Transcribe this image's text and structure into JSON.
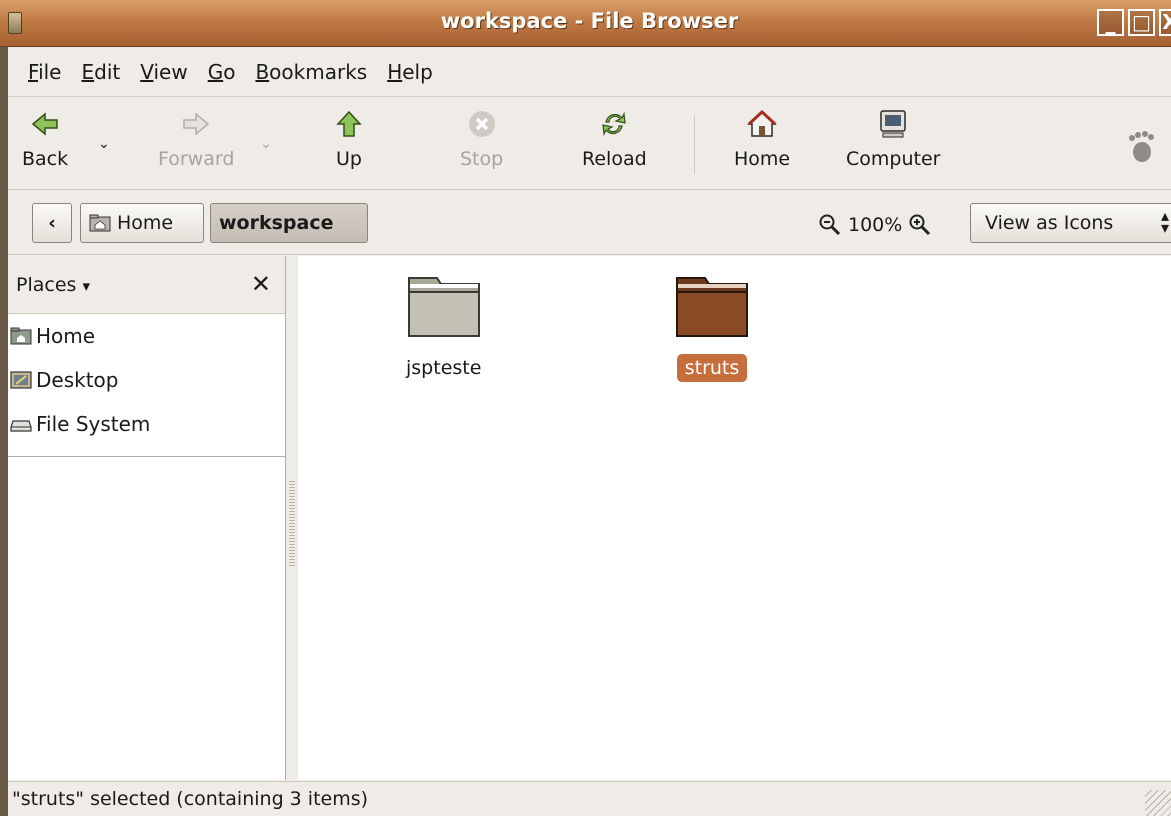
{
  "window": {
    "title": "workspace - File Browser"
  },
  "menubar": {
    "items": [
      {
        "label": "File",
        "mnemonic": "F",
        "rest": "ile"
      },
      {
        "label": "Edit",
        "mnemonic": "E",
        "rest": "dit"
      },
      {
        "label": "View",
        "mnemonic": "V",
        "rest": "iew"
      },
      {
        "label": "Go",
        "mnemonic": "G",
        "rest": "o"
      },
      {
        "label": "Bookmarks",
        "mnemonic": "B",
        "rest": "ookmarks"
      },
      {
        "label": "Help",
        "mnemonic": "H",
        "rest": "elp"
      }
    ]
  },
  "toolbar": {
    "back": "Back",
    "forward": "Forward",
    "up": "Up",
    "stop": "Stop",
    "reload": "Reload",
    "home": "Home",
    "computer": "Computer"
  },
  "location": {
    "crumbs": [
      "Home",
      "workspace"
    ],
    "zoom": "100%",
    "view_mode": "View as Icons"
  },
  "sidebar": {
    "header": "Places",
    "items": [
      "Home",
      "Desktop",
      "File System"
    ]
  },
  "files": [
    {
      "name": "jspteste",
      "selected": false
    },
    {
      "name": "struts",
      "selected": true
    }
  ],
  "status": {
    "text": "\"struts\" selected (containing 3 items)"
  },
  "colors": {
    "selection": "#c66f3d",
    "titlebar": "#c07a45"
  }
}
